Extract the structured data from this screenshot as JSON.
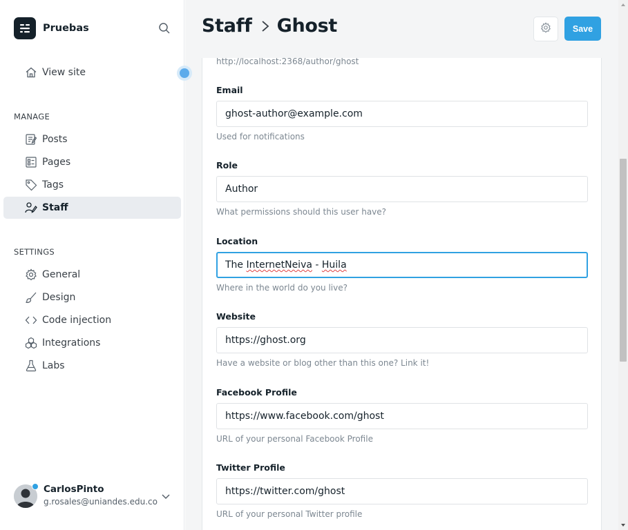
{
  "brand": {
    "name": "Pruebas",
    "icon": "ghost-logo-icon"
  },
  "sidebar": {
    "view_site": "View site",
    "manage_title": "MANAGE",
    "manage_items": [
      {
        "label": "Posts",
        "icon": "posts-icon"
      },
      {
        "label": "Pages",
        "icon": "pages-icon"
      },
      {
        "label": "Tags",
        "icon": "tag-icon"
      },
      {
        "label": "Staff",
        "icon": "staff-icon",
        "active": true
      }
    ],
    "settings_title": "SETTINGS",
    "settings_items": [
      {
        "label": "General",
        "icon": "gear-icon"
      },
      {
        "label": "Design",
        "icon": "brush-icon"
      },
      {
        "label": "Code injection",
        "icon": "code-icon"
      },
      {
        "label": "Integrations",
        "icon": "integrations-icon"
      },
      {
        "label": "Labs",
        "icon": "flask-icon"
      }
    ]
  },
  "user": {
    "name": "CarlosPinto",
    "email": "g.rosales@uniandes.edu.co"
  },
  "header": {
    "crumb_parent": "Staff",
    "crumb_current": "Ghost",
    "save_label": "Save"
  },
  "profile": {
    "url": "http://localhost:2368/author/ghost",
    "fields": {
      "email": {
        "label": "Email",
        "value": "ghost-author@example.com",
        "help": "Used for notifications"
      },
      "role": {
        "label": "Role",
        "value": "Author",
        "help": "What permissions should this user have?"
      },
      "location": {
        "label": "Location",
        "value_a": "The ",
        "value_b": "InternetNeiva",
        "value_c": " - ",
        "value_d": "Huila",
        "help": "Where in the world do you live?"
      },
      "website": {
        "label": "Website",
        "value": "https://ghost.org",
        "help": "Have a website or blog other than this one? Link it!"
      },
      "facebook": {
        "label": "Facebook Profile",
        "value": "https://www.facebook.com/ghost",
        "help": "URL of your personal Facebook Profile"
      },
      "twitter": {
        "label": "Twitter Profile",
        "value": "https://twitter.com/ghost",
        "help": "URL of your personal Twitter profile"
      }
    }
  },
  "colors": {
    "accent": "#30a1e2",
    "text": "#15212a",
    "muted": "#7c8791",
    "active_bg": "#e9ecf0"
  }
}
